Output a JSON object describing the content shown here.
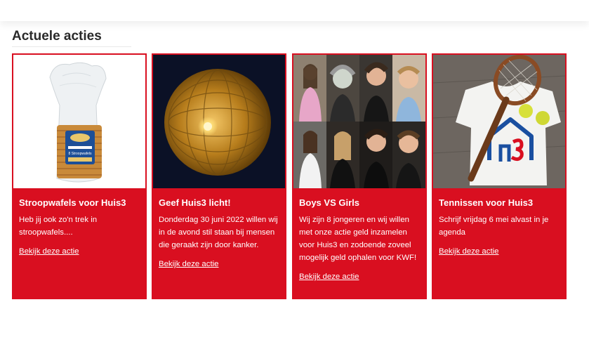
{
  "section": {
    "title": "Actuele acties"
  },
  "cards": [
    {
      "title": "Stroopwafels voor Huis3",
      "description": "Heb jij ook zo'n trek in stroopwafels....",
      "link_label": "Bekijk deze actie",
      "image_icon": "stroopwafel-package-image",
      "package_text": "8 Stroopwafels"
    },
    {
      "title": "Geef Huis3 licht!",
      "description": "Donderdag 30 juni 2022 willen wij in de avond stil staan bij mensen die geraakt zijn door kanker.",
      "link_label": "Bekijk deze actie",
      "image_icon": "paper-lantern-image"
    },
    {
      "title": "Boys VS Girls",
      "description": "Wij zijn 8 jongeren en wij willen met onze actie geld inzamelen voor Huis3 en zodoende zoveel mogelijk geld ophalen voor KWF!",
      "link_label": "Bekijk deze actie",
      "image_icon": "portrait-collage-image"
    },
    {
      "title": "Tennissen voor Huis3",
      "description": "Schrijf vrijdag 6 mei alvast in je agenda",
      "link_label": "Bekijk deze actie",
      "image_icon": "tennis-racket-shirt-image"
    }
  ],
  "colors": {
    "accent": "#d90f20",
    "text_dark": "#2a2a2a",
    "white": "#ffffff"
  }
}
